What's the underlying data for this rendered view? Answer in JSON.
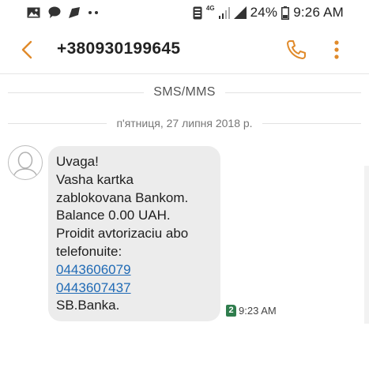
{
  "status_bar": {
    "network_type": "4G",
    "battery_percent": "24%",
    "time": "9:26 AM",
    "icons": [
      "gallery-icon",
      "chat-icon",
      "send-icon",
      "more-dots-icon",
      "tablet-icon",
      "wifi-icon",
      "signal-icon",
      "battery-icon"
    ]
  },
  "header": {
    "contact_number": "+380930199645",
    "back_icon": "chevron-left-icon",
    "call_icon": "phone-icon",
    "more_icon": "vertical-dots-icon",
    "accent_color": "#e08a2a"
  },
  "conversation": {
    "channel_label": "SMS/MMS",
    "date_label": "п'ятниця, 27 липня 2018 р."
  },
  "message": {
    "lines": [
      "Uvaga!",
      "Vasha kartka",
      "zablokovana Bankom.",
      "Balance 0.00 UAH.",
      "Proidit avtorizaciu abo",
      "telefonuite:"
    ],
    "phone_links": [
      "0443606079",
      "0443607437"
    ],
    "signature": "SB.Banka.",
    "sim_slot": "2",
    "time": "9:23 AM",
    "bubble_color": "#ececec",
    "link_color": "#1f6ab5",
    "sim_badge_color": "#2f7d4d"
  }
}
